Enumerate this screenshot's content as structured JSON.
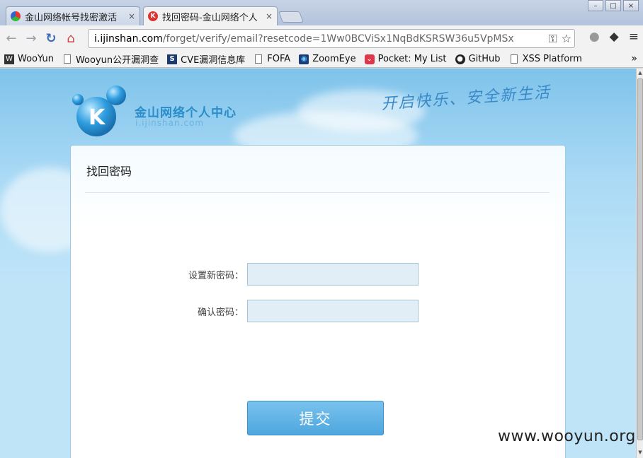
{
  "browser": {
    "tabs": [
      {
        "title": "金山网络帐号找密激活",
        "close": "×",
        "icon": "jinshan-colorful-icon",
        "active": false
      },
      {
        "title": "找回密码-金山网络个人",
        "close": "×",
        "icon": "kingsoft-k-red-icon",
        "active": true
      }
    ],
    "window_buttons": [
      "–",
      "□",
      "×"
    ],
    "url_host": "i.ijinshan.com",
    "url_path": "/forget/verify/email?resetcode=1Ww0BCViSx1NqBdKSRSW36u5VpMSx"
  },
  "bookmarks": [
    {
      "label": "WooYun",
      "icon": "wooyun-icon"
    },
    {
      "label": "Wooyun公开漏洞查",
      "icon": "page-icon"
    },
    {
      "label": "CVE漏洞信息库",
      "icon": "cve-s-icon"
    },
    {
      "label": "FOFA",
      "icon": "page-icon"
    },
    {
      "label": "ZoomEye",
      "icon": "eye-icon"
    },
    {
      "label": "Pocket: My List",
      "icon": "pocket-icon"
    },
    {
      "label": "GitHub",
      "icon": "github-icon"
    },
    {
      "label": "XSS Platform",
      "icon": "page-icon"
    }
  ],
  "bookmarks_more": "»",
  "page": {
    "logo_title": "金山网络个人中心",
    "logo_subtitle": "i.ijinshan.com",
    "logo_letter": "K",
    "slogan": "开启快乐、安全新生活",
    "panel_title": "找回密码",
    "new_password_label": "设置新密码：",
    "confirm_password_label": "确认密码：",
    "submit_label": "提交"
  },
  "watermark": "www.wooyun.org",
  "colors": {
    "page_bg": "#a9d9f5",
    "accent": "#4ea6de",
    "logo_blue": "#2a8dcb"
  }
}
